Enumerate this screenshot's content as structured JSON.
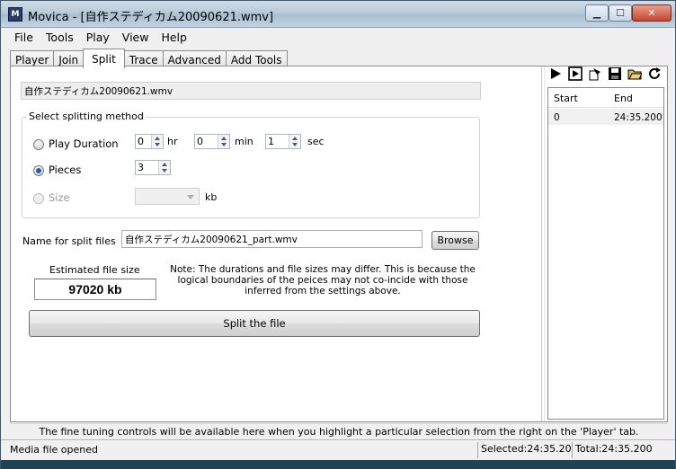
{
  "window": {
    "title": "Movica - [自作ステディカム20090621.wmv]",
    "icon_text": "M",
    "min_glyph": "▁",
    "max_glyph": "☐",
    "close_glyph": "✕"
  },
  "menu": [
    "File",
    "Tools",
    "Play",
    "View",
    "Help"
  ],
  "tabs": [
    {
      "label": "Player",
      "active": false
    },
    {
      "label": "Join",
      "active": false
    },
    {
      "label": "Split",
      "active": true
    },
    {
      "label": "Trace",
      "active": false
    },
    {
      "label": "Advanced",
      "active": false
    },
    {
      "label": "Add Tools",
      "active": false
    }
  ],
  "split": {
    "file_name": "自作ステディカム20090621.wmv",
    "method_legend": "Select splitting method",
    "options": {
      "duration": {
        "label": "Play Duration",
        "checked": false,
        "hr": "0",
        "min": "0",
        "sec": "1"
      },
      "pieces": {
        "label": "Pieces",
        "checked": true,
        "value": "3"
      },
      "size": {
        "label": "Size",
        "checked": false,
        "enabled": false,
        "unit": "kb"
      }
    },
    "units": {
      "hr": "hr",
      "min": "min",
      "sec": "sec"
    },
    "name_label": "Name for split files",
    "name_value": "自作ステディカム20090621_part.wmv",
    "browse_label": "Browse",
    "estimated_label": "Estimated file size",
    "estimated_value": "97020 kb",
    "note": "Note: The durations and file sizes may differ. This is because the logical boundaries of the peices may not co-incide with those inferred from the settings above.",
    "split_button": "Split the file"
  },
  "toolbar_icons": [
    "play-icon",
    "play-selection-icon",
    "export-icon",
    "save-icon",
    "open-folder-icon",
    "refresh-icon"
  ],
  "selections": {
    "columns": [
      "Start",
      "End"
    ],
    "rows": [
      {
        "start": "0",
        "end": "24:35.200"
      }
    ]
  },
  "hint": "The fine tuning controls will be available here when you highlight a particular selection from the right on the 'Player' tab.",
  "status": {
    "message": "Media file opened",
    "selected": "Selected:24:35.20",
    "total": "Total:24:35.200"
  },
  "colors": {
    "title_bar": "#b8cad9",
    "close_button": "#c8442c",
    "accent_radio": "#1e5fb4"
  }
}
